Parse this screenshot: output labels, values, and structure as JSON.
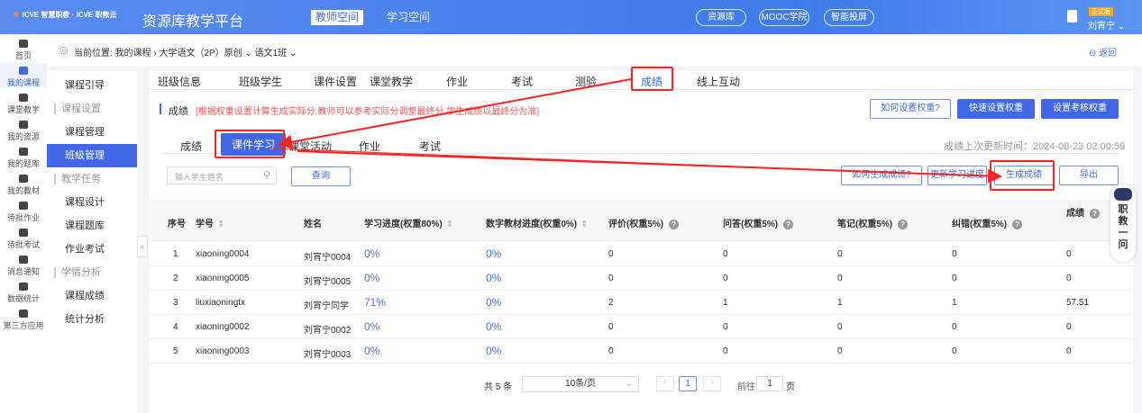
{
  "header": {
    "logo_text": "ICVE 智慧职教 · ICVE 职教云",
    "platform": "资源库教学平台",
    "spaces": [
      "教师空间",
      "学习空间"
    ],
    "links": [
      "资源库",
      "MOOC学院",
      "智能投屏"
    ],
    "badge": "正式版",
    "user": "刘宵宁"
  },
  "nav": [
    {
      "label": "首页"
    },
    {
      "label": "我的课程"
    },
    {
      "label": "课堂教学"
    },
    {
      "label": "我的资源"
    },
    {
      "label": "我的题库"
    },
    {
      "label": "我的教材"
    },
    {
      "label": "待批作业"
    },
    {
      "label": "待批考试"
    },
    {
      "label": "消息通知"
    },
    {
      "label": "数据统计"
    },
    {
      "label": "第三方应用"
    }
  ],
  "breadcrumb": {
    "prefix": "当前位置:",
    "course_list": "我的课程",
    "course": "大学语文（2P）原创",
    "class": "语文1班",
    "back": "返回"
  },
  "sidebar": [
    {
      "label": "课程引导",
      "type": "item"
    },
    {
      "label": "课程设置",
      "type": "group"
    },
    {
      "label": "课程管理",
      "type": "item"
    },
    {
      "label": "班级管理",
      "type": "item",
      "active": true
    },
    {
      "label": "教学任务",
      "type": "group"
    },
    {
      "label": "课程设计",
      "type": "item"
    },
    {
      "label": "课程题库",
      "type": "item"
    },
    {
      "label": "作业考试",
      "type": "item"
    },
    {
      "label": "学情分析",
      "type": "group"
    },
    {
      "label": "课程成绩",
      "type": "item"
    },
    {
      "label": "统计分析",
      "type": "item"
    }
  ],
  "tabs": [
    "班级信息",
    "班级学生",
    "课件设置",
    "课堂教学",
    "作业",
    "考试",
    "测验",
    "成绩",
    "线上互动"
  ],
  "active_tab": "成绩",
  "info": {
    "title": "成绩",
    "note": "[根据权重设置计算生成实际分,教师可以参考实际分调整最终分,学生成绩以最终分为准]"
  },
  "buttons": {
    "how_weight": "如何设置权重?",
    "quick_weight": "快速设置权重",
    "exam_weight": "设置考核权重",
    "how_generate": "如何生成成绩?",
    "update_progress": "更新学习进度",
    "generate": "生成成绩",
    "export": "导出",
    "query": "查询"
  },
  "subtabs": [
    "成绩",
    "课件学习",
    "课堂活动",
    "作业",
    "考试"
  ],
  "update_time": "成绩上次更新时间：2024-08-23 02:00:59",
  "search": {
    "placeholder": "输入学生姓名"
  },
  "table": {
    "headers": [
      "序号",
      "学号",
      "姓名",
      "学习进度(权重80%)",
      "数字教材进度(权重0%)",
      "评价(权重5%)",
      "问答(权重5%)",
      "笔记(权重5%)",
      "纠错(权重5%)",
      "成绩"
    ],
    "rows": [
      [
        "1",
        "xiaoning0004",
        "刘宵宁0004",
        "0%",
        "0%",
        "0",
        "0",
        "0",
        "0",
        "0"
      ],
      [
        "2",
        "xiaoning0005",
        "刘宵宁0005",
        "0%",
        "0%",
        "0",
        "0",
        "0",
        "0",
        "0"
      ],
      [
        "3",
        "liuxiaoningtx",
        "刘宵宁同学",
        "71%",
        "0%",
        "2",
        "1",
        "1",
        "1",
        "57.51"
      ],
      [
        "4",
        "xiaoning0002",
        "刘宵宁0002",
        "0%",
        "0%",
        "0",
        "0",
        "0",
        "0",
        "0"
      ],
      [
        "5",
        "xiaoning0003",
        "刘宵宁0003",
        "0%",
        "0%",
        "0",
        "0",
        "0",
        "0",
        "0"
      ]
    ]
  },
  "pagination": {
    "total": "共 5 条",
    "page_size": "10条/页",
    "current": "1",
    "goto": "前往",
    "goto_value": "1",
    "page_unit": "页"
  },
  "assistant": {
    "label": "职教一问"
  },
  "colors": {
    "primary": "#4068e4",
    "annotation": "#ff2222"
  }
}
